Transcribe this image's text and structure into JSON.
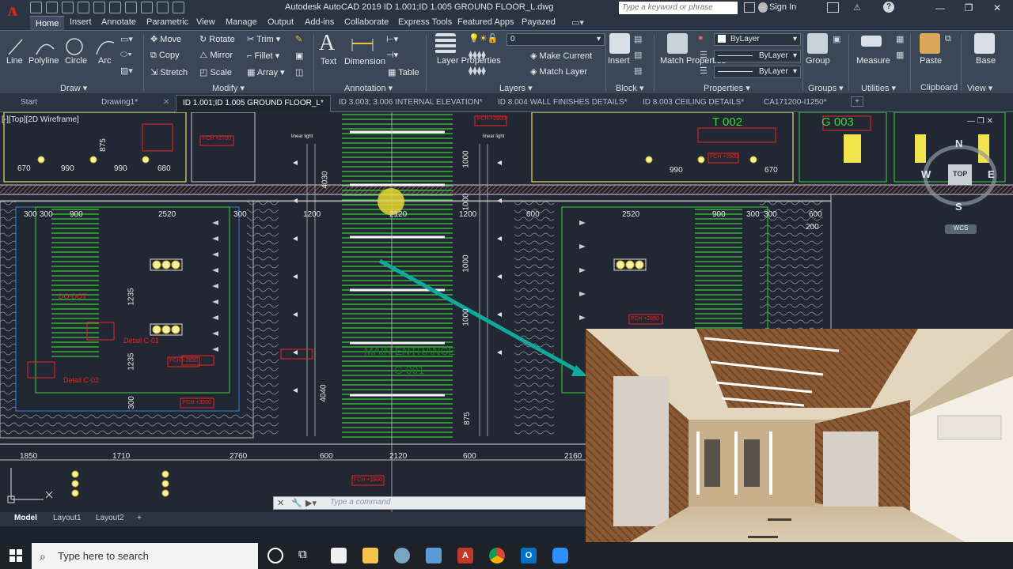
{
  "app": {
    "title": "Autodesk AutoCAD 2019   ID 1.001;ID 1.005 GROUND FLOOR_L.dwg",
    "logo_letter": "A",
    "search_placeholder": "Type a keyword or phrase",
    "sign_in": "Sign In"
  },
  "ribbon_tabs": [
    "Home",
    "Insert",
    "Annotate",
    "Parametric",
    "View",
    "Manage",
    "Output",
    "Add-ins",
    "Collaborate",
    "Express Tools",
    "Featured Apps",
    "Payazed"
  ],
  "draw": {
    "title": "Draw",
    "line": "Line",
    "polyline": "Polyline",
    "circle": "Circle",
    "arc": "Arc"
  },
  "modify": {
    "title": "Modify",
    "move": "Move",
    "rotate": "Rotate",
    "trim": "Trim",
    "copy": "Copy",
    "mirror": "Mirror",
    "fillet": "Fillet",
    "stretch": "Stretch",
    "scale": "Scale",
    "array": "Array"
  },
  "annotation": {
    "title": "Annotation",
    "text": "Text",
    "dimension": "Dimension",
    "table": "Table"
  },
  "layers": {
    "title": "Layers",
    "layer_properties": "Layer Properties",
    "make_current": "Make Current",
    "match_layer": "Match Layer",
    "current_layer": "0"
  },
  "block": {
    "title": "Block",
    "insert": "Insert"
  },
  "properties": {
    "title": "Properties",
    "match_properties": "Match Properties",
    "color": "ByLayer",
    "linetype": "ByLayer",
    "lineweight": "ByLayer"
  },
  "groups": {
    "title": "Groups",
    "group": "Group"
  },
  "utilities": {
    "title": "Utilities",
    "measure": "Measure"
  },
  "clipboard": {
    "title": "Clipboard",
    "paste": "Paste"
  },
  "view": {
    "title": "View",
    "base": "Base"
  },
  "doc_tabs": [
    "Start",
    "Drawing1*",
    "ID 1.001;ID 1.005 GROUND FLOOR_L*",
    "ID 3.003; 3.006 INTERNAL ELEVATION*",
    "ID 8.004 WALL FINISHES DETAILS*",
    "ID 8.003 CEILING  DETAILS*",
    "CA171200-I1250*"
  ],
  "viewport_label": "[-][Top][2D Wireframe]",
  "viewcube": {
    "n": "N",
    "s": "S",
    "e": "E",
    "w": "W",
    "top": "TOP",
    "wcs": "WCS"
  },
  "drawing_text": {
    "dims_top": [
      "670",
      "990",
      "990",
      "680",
      "990",
      "670"
    ],
    "dims_mid": [
      "300",
      "300",
      "900",
      "2520",
      "300",
      "1200",
      "2120",
      "1200",
      "600",
      "2520",
      "900",
      "300",
      "300",
      "600"
    ],
    "dims_bottom": [
      "1850",
      "1710",
      "2760",
      "600",
      "2120",
      "600",
      "2160"
    ],
    "vertical_dims": [
      "4030",
      "1000",
      "1000",
      "1235",
      "1235",
      "875",
      "1000",
      "4040",
      "300",
      "875",
      "1000"
    ],
    "room_tags": [
      "T 002",
      "G 003",
      "MAIN ENTRANCE",
      "G 001"
    ],
    "fch_tags": [
      "FCH +2700",
      "FCH +2800",
      "FCH +2850",
      "FCH +3000",
      "FCH +2500",
      "FCH +2800",
      "FCH +2850"
    ],
    "details": [
      "Detail C-01",
      "Detail C-02"
    ],
    "linear_light": "linear light",
    "other": [
      "200",
      "DO-DOT"
    ]
  },
  "command": {
    "placeholder": "Type a command"
  },
  "layout_tabs": [
    "Model",
    "Layout1",
    "Layout2"
  ],
  "taskbar": {
    "search": "Type here to search"
  },
  "colors": {
    "accent_cyan": "#13a89e",
    "hatch_green": "#3cd43c",
    "wall_gray": "#9aa0a6",
    "red": "#e22",
    "yellow": "#f2e44c"
  }
}
